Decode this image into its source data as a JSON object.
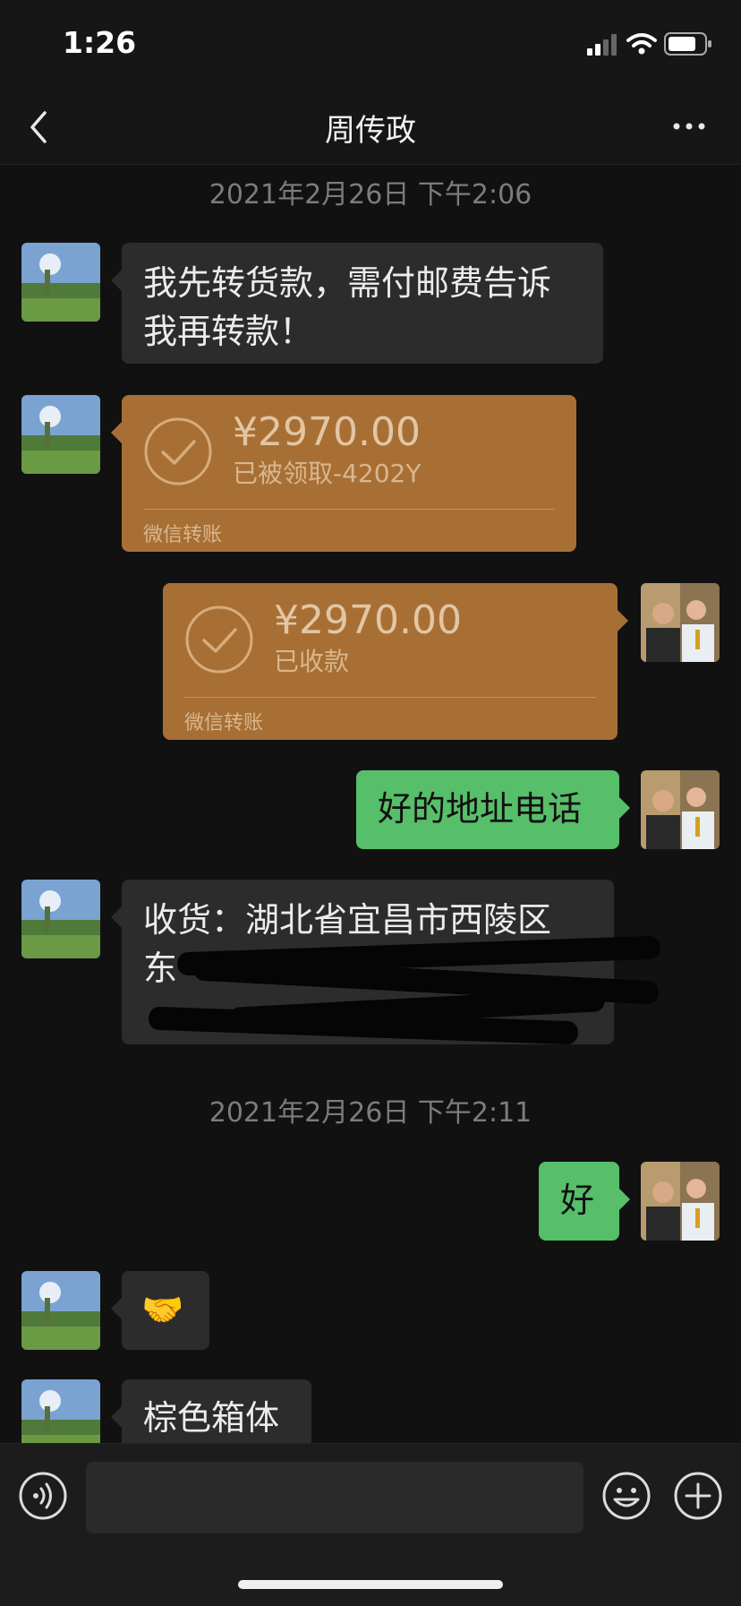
{
  "status_bar": {
    "time": "1:26"
  },
  "nav": {
    "title": "周传政"
  },
  "chat": {
    "timestamps": [
      "2021年2月26日 下午2:06",
      "2021年2月26日 下午2:11"
    ],
    "messages": {
      "m1_line1": "我先转货款，需付邮费告诉",
      "m1_line2": "我再转款！",
      "transfer_sent": {
        "amount": "¥2970.00",
        "status": "已被领取-4202Y",
        "label": "微信转账"
      },
      "transfer_received": {
        "amount": "¥2970.00",
        "status": "已收款",
        "label": "微信转账"
      },
      "m4": "好的地址电话",
      "m5_line1": "收货：湖北省宜昌市西陵区",
      "m5_line2": "东",
      "m6": "好",
      "m7": "🤝",
      "m8": "棕色箱体"
    }
  },
  "input_bar": {
    "placeholder": ""
  },
  "colors": {
    "accent_green": "#57be6a",
    "transfer_orange": "#a86f35",
    "bg": "#111111"
  },
  "icons": [
    "back-icon",
    "more-icon",
    "voice-icon",
    "emoji-icon",
    "add-icon",
    "check-circle-icon",
    "signal-icon",
    "wifi-icon",
    "battery-icon"
  ]
}
